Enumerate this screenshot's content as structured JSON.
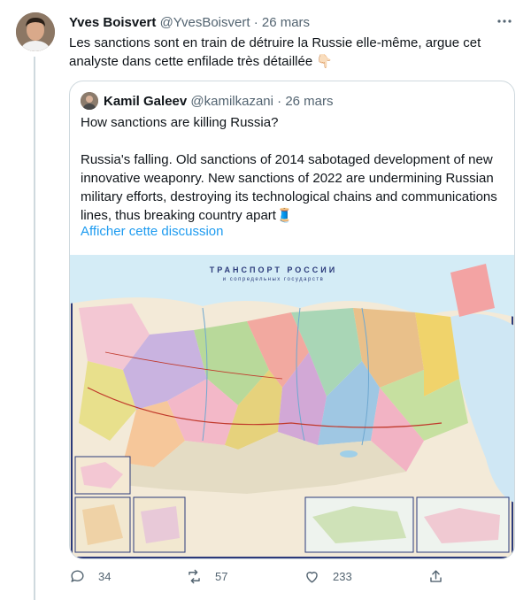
{
  "tweet": {
    "author_name": "Yves Boisvert",
    "author_handle": "@YvesBoisvert",
    "separator": "·",
    "date": "26 mars",
    "text": "Les sanctions sont en train de détruire la Russie elle-même, argue cet analyste dans cette enfilade très détaillée 👇🏻"
  },
  "quoted_tweet": {
    "author_name": "Kamil Galeev",
    "author_handle": "@kamilkazani",
    "separator": "·",
    "date": "26 mars",
    "paragraphs": [
      "How sanctions are killing Russia?",
      "Russia's falling. Old sanctions of 2014 sabotaged development of new innovative weaponry. New sanctions of 2022 are undermining Russian military efforts, destroying its technological chains and communications lines, thus breaking country apart🧵"
    ],
    "show_thread_label": "Afficher cette discussion",
    "map": {
      "title": "ТРАНСПОРТ РОССИИ",
      "subtitle": "и сопредельных государств"
    }
  },
  "actions": {
    "reply_count": "34",
    "retweet_count": "57",
    "like_count": "233"
  },
  "colors": {
    "link": "#1d9bf0",
    "muted": "#536471",
    "border": "#cfd9de"
  }
}
